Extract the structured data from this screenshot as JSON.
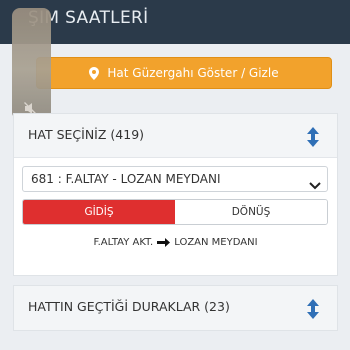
{
  "header": {
    "title": "ŞIM SAATLERİ"
  },
  "route_button": {
    "label": "Hat Güzergahı Göster / Gizle"
  },
  "lines_card": {
    "title": "HAT SEÇİNİZ (419)",
    "selected_line": "681 : F.ALTAY - LOZAN MEYDANI",
    "tabs": [
      {
        "label": "GİDİŞ"
      },
      {
        "label": "DÖNÜŞ"
      }
    ],
    "direction": {
      "from": "F.ALTAY AKT.",
      "to": "LOZAN MEYDANI"
    }
  },
  "stops_card": {
    "title": "HATTIN GEÇTİĞİ DURAKLAR (23)"
  },
  "colors": {
    "header_bg": "#2b3a4a",
    "accent_orange": "#f2a22c",
    "active_tab_red": "#df2f2f",
    "sort_icon_blue": "#2f6fb6"
  }
}
